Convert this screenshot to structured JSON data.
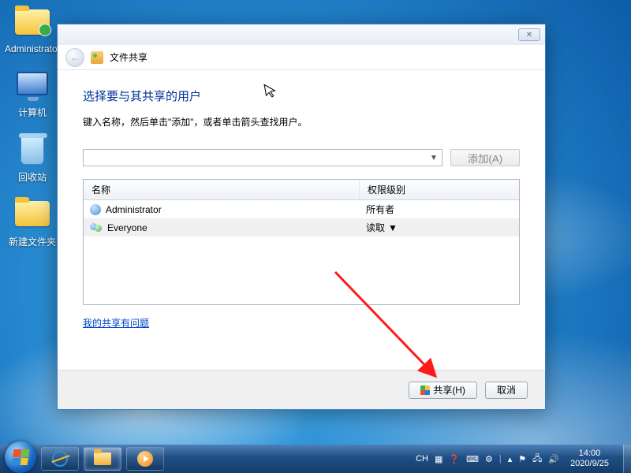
{
  "desktop": {
    "icons": [
      {
        "label": "Administrator"
      },
      {
        "label": "计算机"
      },
      {
        "label": "回收站"
      },
      {
        "label": "新建文件夹"
      }
    ]
  },
  "dialog": {
    "titlebar_text": "文件共享",
    "heading": "选择要与其共享的用户",
    "instruction": "键入名称，然后单击\"添加\"，或者单击箭头查找用户。",
    "add_button": "添加(A)",
    "columns": {
      "name": "名称",
      "permission": "权限级别"
    },
    "rows": [
      {
        "name": "Administrator",
        "permission": "所有者",
        "dropdown": false
      },
      {
        "name": "Everyone",
        "permission": "读取",
        "dropdown": true
      }
    ],
    "help_link": "我的共享有问题",
    "share_button": "共享(H)",
    "cancel_button": "取消"
  },
  "taskbar": {
    "ime": "CH",
    "time": "14:00",
    "date": "2020/9/25"
  }
}
